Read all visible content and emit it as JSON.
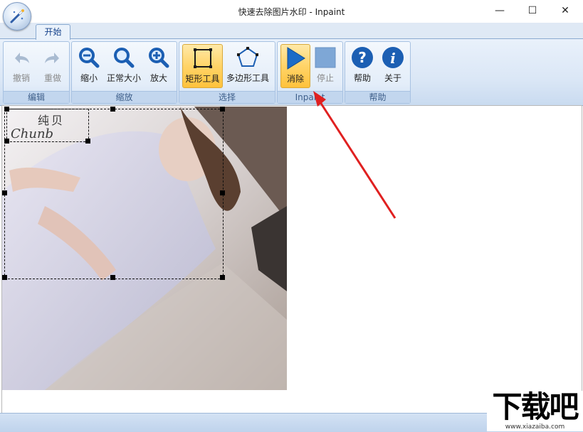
{
  "window": {
    "title": "快速去除图片水印 - Inpaint",
    "minimize": "—",
    "maximize": "☐",
    "close": "✕"
  },
  "ribbon": {
    "tab": "开始",
    "groups": {
      "edit": {
        "label": "编辑",
        "undo": "撤销",
        "redo": "重做"
      },
      "zoom": {
        "label": "缩放",
        "zoom_out": "缩小",
        "actual": "正常大小",
        "zoom_in": "放大"
      },
      "select": {
        "label": "选择",
        "rect": "矩形工具",
        "poly": "多边形工具"
      },
      "inpaint": {
        "label": "Inpaint",
        "erase": "消除",
        "stop": "停止"
      },
      "help": {
        "label": "帮助",
        "help": "帮助",
        "about": "关于"
      }
    }
  },
  "photo_caption": {
    "line1": "纯贝",
    "line2": "Chunb"
  },
  "watermark": {
    "brand": "下载吧",
    "url": "www.xiazaiba.com"
  },
  "colors": {
    "accent_arrow": "#e02020",
    "active_button": "#ffd468",
    "ribbon_border": "#8aaad0"
  }
}
